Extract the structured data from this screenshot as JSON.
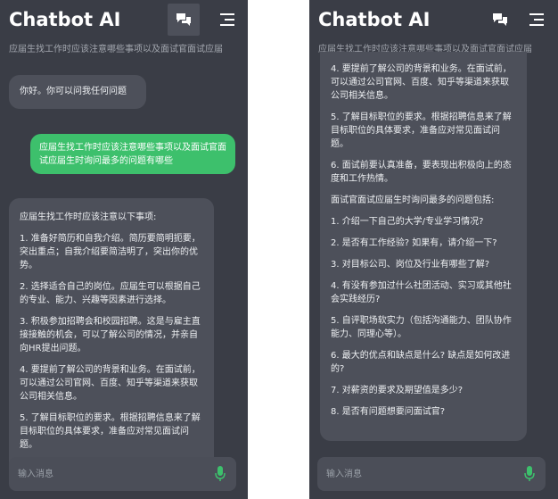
{
  "app_title": "Chatbot AI",
  "subtitle": "应届生找工作时应该注意哪些事项以及面试官面试应届",
  "colors": {
    "background": "#3a3d46",
    "bot_bubble": "#4d505a",
    "user_bubble": "#3dc06c",
    "accent": "#3dc06c"
  },
  "icons": {
    "chat": "chat-bubbles-icon",
    "menu": "menu-icon",
    "mic": "microphone-icon"
  },
  "left": {
    "greeting": "你好。你可以问我任何问题",
    "user_message": "应届生找工作时应该注意哪些事项以及面试官面试应届生时询问最多的问题有哪些",
    "reply": [
      "应届生找工作时应该注意以下事项:",
      "1. 准备好简历和自我介绍。简历要简明扼要，突出重点；自我介绍要简洁明了，突出你的优势。",
      "2. 选择适合自己的岗位。应届生可以根据自己的专业、能力、兴趣等因素进行选择。",
      "3. 积极参加招聘会和校园招聘。这是与雇主直接接触的机会，可以了解公司的情况，并亲自向HR提出问题。",
      "4. 要提前了解公司的背景和业务。在面试前，可以通过公司官网、百度、知乎等渠道来获取公司相关信息。",
      "5. 了解目标职位的要求。根据招聘信息来了解目标职位的具体要求，准备应对常见面试问题。"
    ]
  },
  "right": {
    "reply": [
      "4. 要提前了解公司的背景和业务。在面试前，可以通过公司官网、百度、知乎等渠道来获取公司相关信息。",
      "5. 了解目标职位的要求。根据招聘信息来了解目标职位的具体要求，准备应对常见面试问题。",
      "6. 面试前要认真准备，要表现出积极向上的态度和工作热情。",
      "面试官面试应届生时询问最多的问题包括:",
      "1. 介绍一下自己的大学/专业学习情况?",
      "2. 是否有工作经验? 如果有，请介绍一下?",
      "3. 对目标公司、岗位及行业有哪些了解?",
      "4. 有没有参加过什么社团活动、实习或其他社会实践经历?",
      "5. 自评职场软实力（包括沟通能力、团队协作能力、同理心等）。",
      "6. 最大的优点和缺点是什么? 缺点是如何改进的?",
      "7. 对薪资的要求及期望值是多少?",
      "8. 是否有问题想要问面试官?"
    ]
  },
  "input": {
    "placeholder": "输入消息"
  }
}
